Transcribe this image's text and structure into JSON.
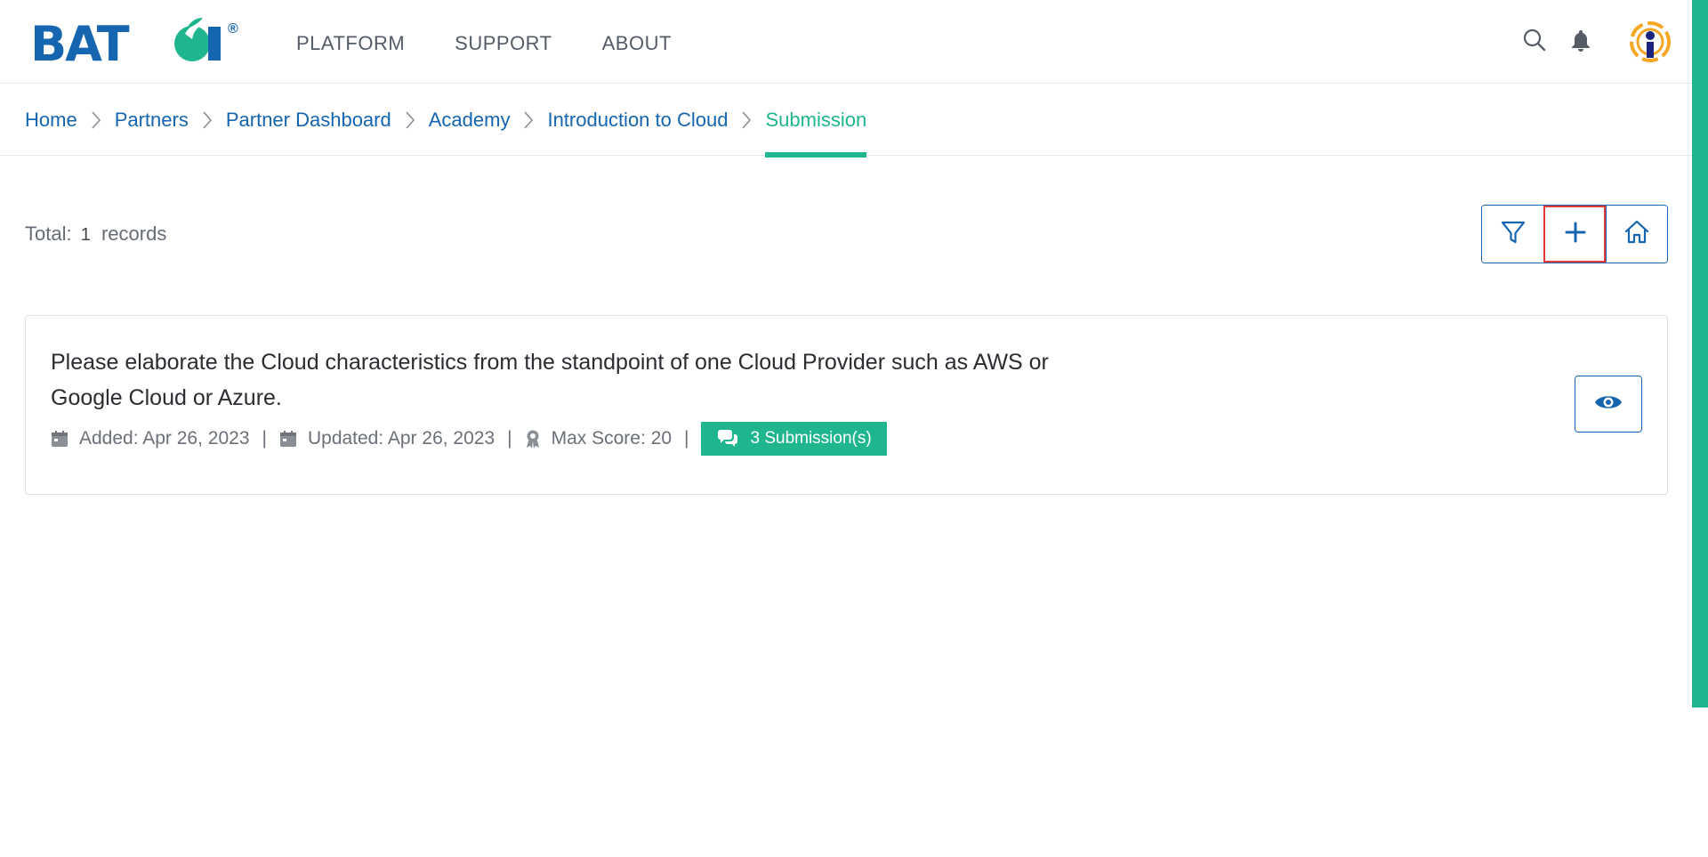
{
  "brand": {
    "logo_text": "BATOI",
    "reg_mark": "®",
    "primary": "#1565b0",
    "accent": "#1fb58f"
  },
  "nav": {
    "items": [
      {
        "label": "PLATFORM"
      },
      {
        "label": "SUPPORT"
      },
      {
        "label": "ABOUT"
      }
    ]
  },
  "header_icons": {
    "search": "search-icon",
    "notifications": "bell-icon",
    "avatar": "user-avatar"
  },
  "breadcrumb": {
    "items": [
      {
        "label": "Home"
      },
      {
        "label": "Partners"
      },
      {
        "label": "Partner Dashboard"
      },
      {
        "label": "Academy"
      },
      {
        "label": "Introduction to Cloud"
      },
      {
        "label": "Submission",
        "active": true
      }
    ]
  },
  "toolbar": {
    "total_label": "Total:",
    "total_count": "1",
    "records_label": "records",
    "buttons": [
      {
        "icon": "filter-icon"
      },
      {
        "icon": "plus-icon",
        "highlighted": true
      },
      {
        "icon": "home-icon"
      }
    ]
  },
  "records": [
    {
      "title": "Please elaborate the Cloud characteristics from the standpoint of one Cloud Provider such as AWS or Google Cloud or Azure.",
      "added": "Added: Apr 26, 2023",
      "updated": "Updated: Apr 26, 2023",
      "max_score": "Max Score: 20",
      "submissions": "3 Submission(s)"
    }
  ]
}
